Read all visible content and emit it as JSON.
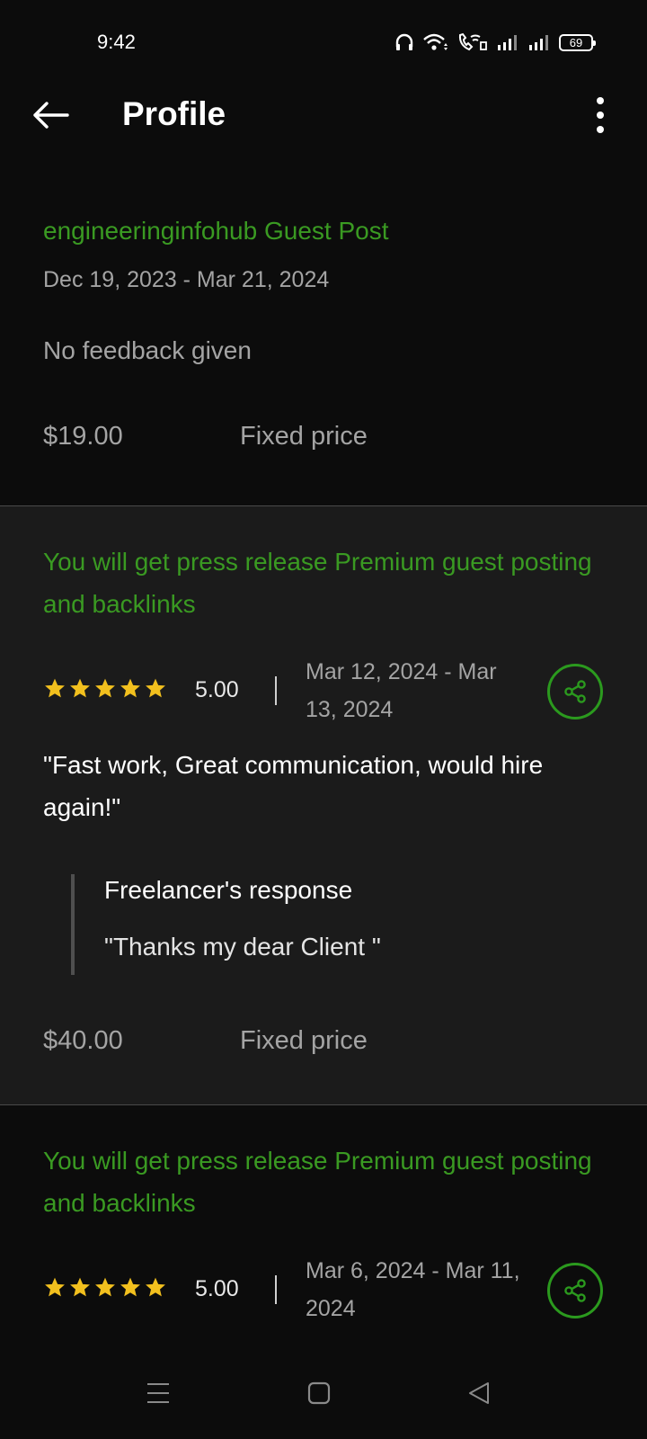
{
  "status_bar": {
    "time": "9:42",
    "battery_level": "69",
    "icons": [
      "headphones-icon",
      "wifi-icon",
      "volte-call-icon",
      "signal-icon",
      "signal-icon",
      "battery-icon"
    ]
  },
  "app_bar": {
    "title": "Profile",
    "back_icon": "arrow-left-icon",
    "menu_icon": "more-vertical-icon"
  },
  "colors": {
    "background": "#0c0c0c",
    "card_highlight": "#1b1b1b",
    "accent_green": "#3a9a22",
    "star_yellow": "#f2c01e",
    "muted_text": "#a4a4a4"
  },
  "jobs": [
    {
      "title": "engineeringinfohub Guest Post",
      "dates": "Dec 19, 2023 - Mar 21, 2024",
      "feedback": "No feedback given",
      "price": "$19.00",
      "price_type": "Fixed price"
    },
    {
      "title": "You will get press release Premium guest posting and backlinks",
      "rating": "5.00",
      "rating_stars": 5,
      "dates": "Mar 12, 2024 - Mar 13, 2024",
      "review": "\"Fast work, Great communication, would hire again!\"",
      "response_heading": "Freelancer's response",
      "response": "\"Thanks my dear Client \"",
      "price": "$40.00",
      "price_type": "Fixed price",
      "share_icon": "share-icon"
    },
    {
      "title": "You will get press release Premium guest posting and backlinks",
      "rating": "5.00",
      "rating_stars": 5,
      "dates": "Mar 6, 2024 - Mar 11, 2024",
      "share_icon": "share-icon"
    }
  ],
  "nav_bar": {
    "buttons": [
      "menu-icon",
      "home-square-icon",
      "back-triangle-icon"
    ]
  }
}
